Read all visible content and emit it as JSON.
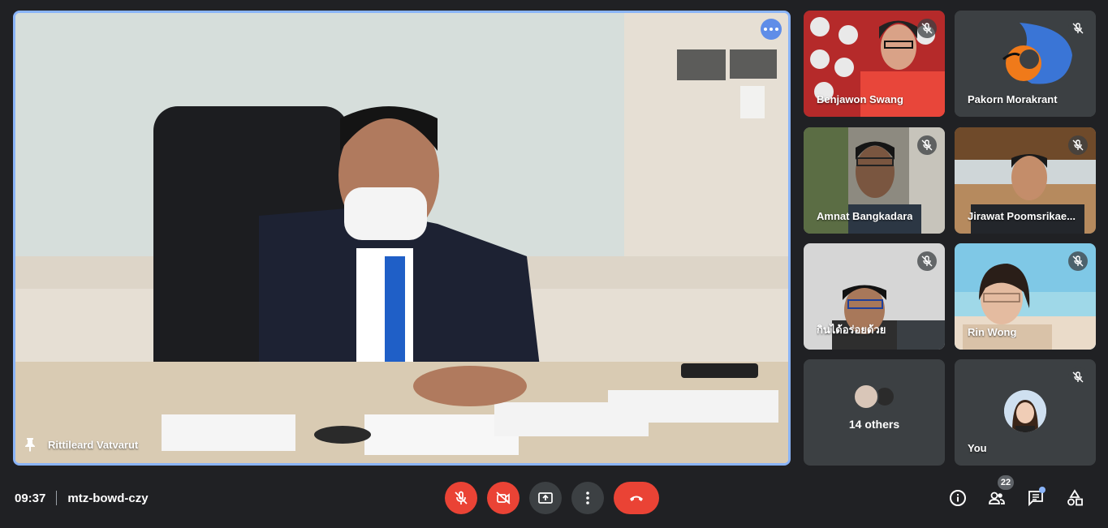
{
  "main": {
    "speaker_name": "Rittileard Vatvarut",
    "pin_icon": "pin-icon",
    "more_icon": "more-options-icon"
  },
  "participants": [
    {
      "name": "Benjawon Swang",
      "muted": true
    },
    {
      "name": "Pakorn Morakrant",
      "muted": true
    },
    {
      "name": "Amnat Bangkadara",
      "muted": true
    },
    {
      "name": "Jirawat Poomsrikae...",
      "muted": true
    },
    {
      "name": "กินได้อร่อยด้วย",
      "muted": true
    },
    {
      "name": "Rin Wong",
      "muted": true
    }
  ],
  "others": {
    "label": "14 others"
  },
  "you": {
    "name": "You",
    "muted": true
  },
  "bottom": {
    "time": "09:37",
    "meeting_code": "mtz-bowd-czy",
    "people_count": "22"
  },
  "colors": {
    "background": "#202124",
    "tile": "#3c4043",
    "danger": "#ea4335",
    "accent": "#8ab4f8"
  }
}
